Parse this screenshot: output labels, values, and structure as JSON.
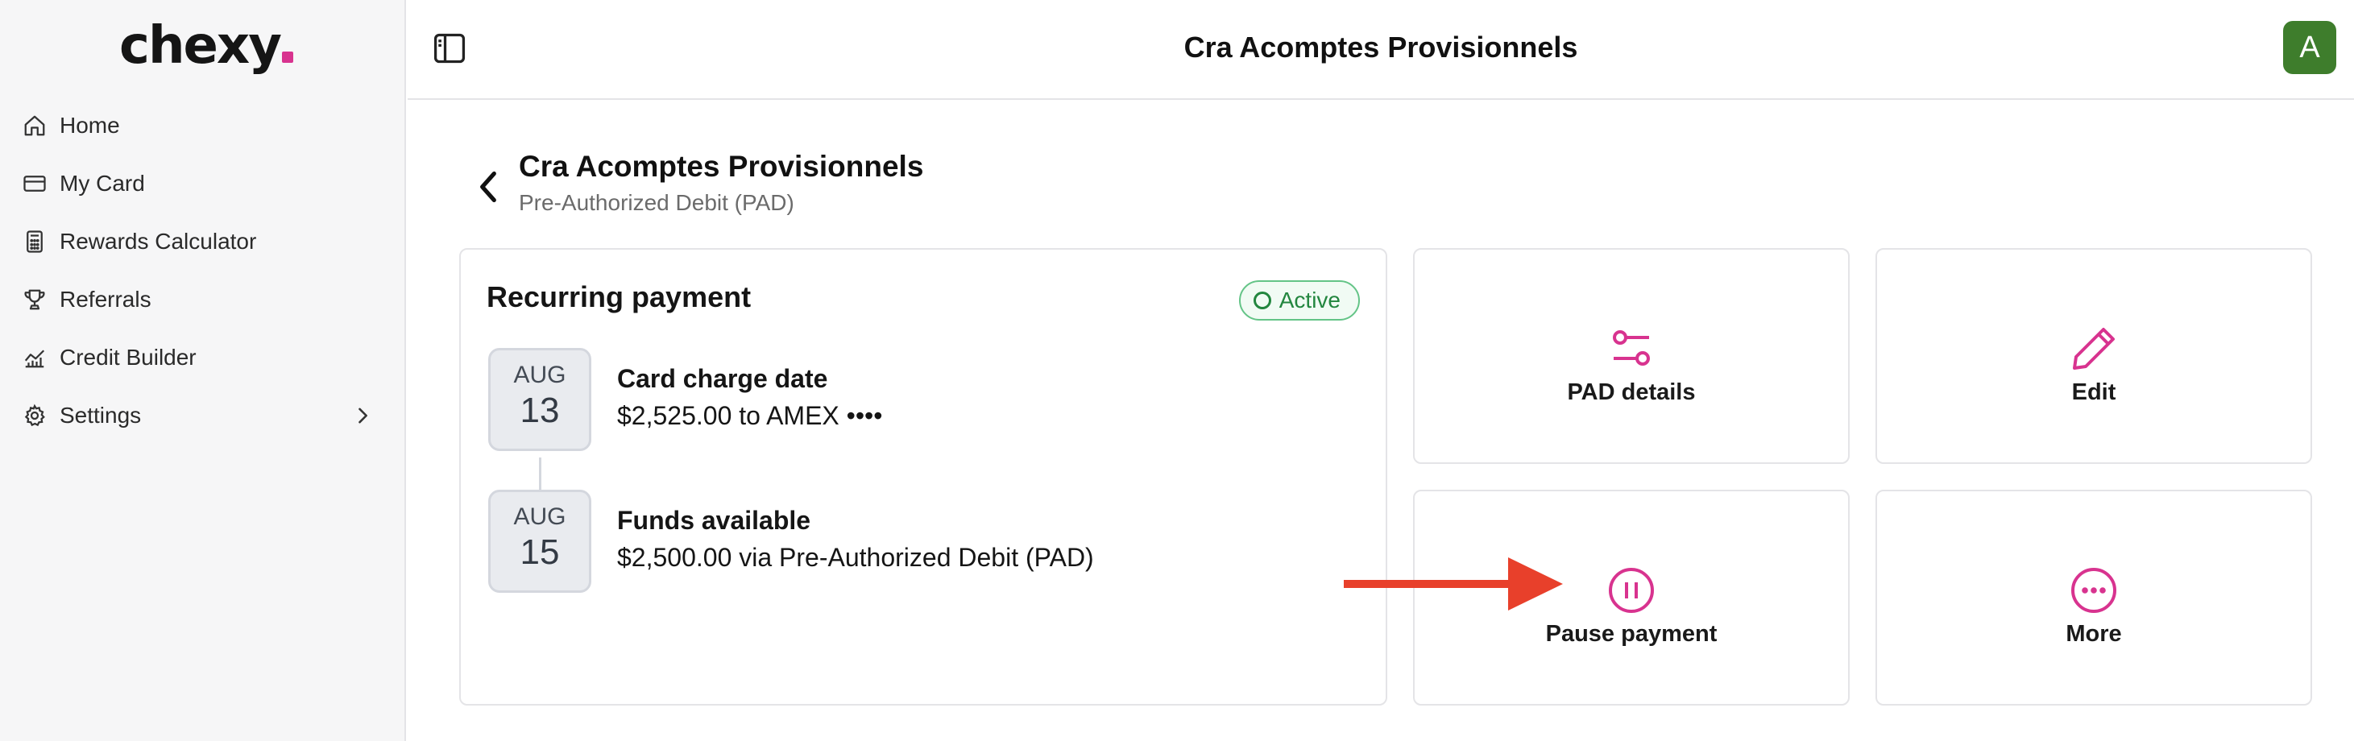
{
  "app": {
    "logo": "chexy"
  },
  "sidebar": {
    "items": [
      {
        "label": "Home",
        "icon": "home-icon"
      },
      {
        "label": "My Card",
        "icon": "credit-card-icon"
      },
      {
        "label": "Rewards Calculator",
        "icon": "calculator-icon"
      },
      {
        "label": "Referrals",
        "icon": "trophy-icon"
      },
      {
        "label": "Credit Builder",
        "icon": "chart-line-icon"
      },
      {
        "label": "Settings",
        "icon": "gear-icon"
      }
    ]
  },
  "header": {
    "title": "Cra Acomptes Provisionnels",
    "avatar_letter": "A"
  },
  "page": {
    "title": "Cra Acomptes Provisionnels",
    "subtitle": "Pre-Authorized Debit (PAD)"
  },
  "recurring": {
    "title": "Recurring payment",
    "status": "Active",
    "events": [
      {
        "month": "AUG",
        "day": "13",
        "title": "Card charge date",
        "desc": "$2,525.00 to AMEX ••••"
      },
      {
        "month": "AUG",
        "day": "15",
        "title": "Funds available",
        "desc": "$2,500.00 via Pre-Authorized Debit (PAD)"
      }
    ]
  },
  "actions": {
    "pad_details": "PAD details",
    "edit": "Edit",
    "pause": "Pause payment",
    "more": "More"
  },
  "colors": {
    "accent": "#d8338f",
    "active_green": "#23863f",
    "avatar_bg": "#3e7d2c",
    "arrow_red": "#e8402b"
  }
}
